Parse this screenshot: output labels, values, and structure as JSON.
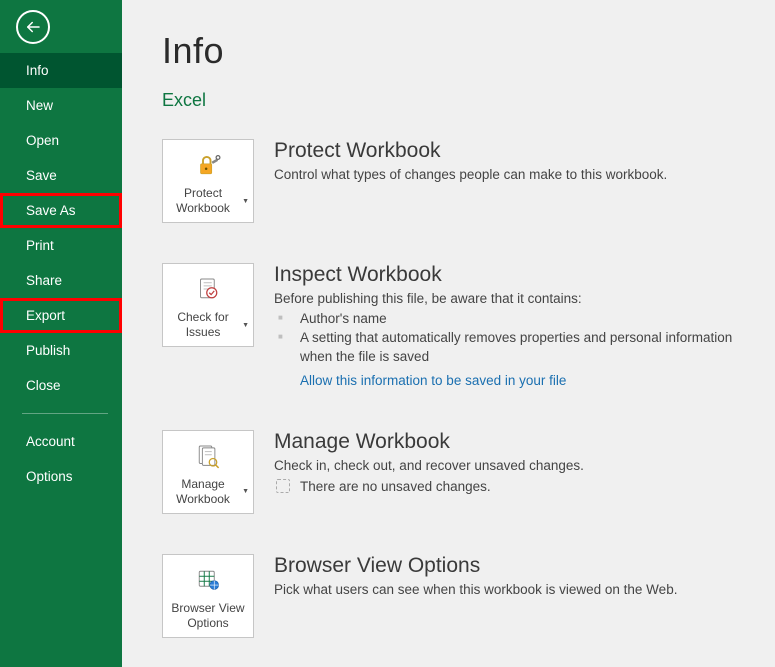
{
  "sidebar": {
    "items": [
      {
        "label": "Info",
        "active": true,
        "highlight": false
      },
      {
        "label": "New",
        "active": false,
        "highlight": false
      },
      {
        "label": "Open",
        "active": false,
        "highlight": false
      },
      {
        "label": "Save",
        "active": false,
        "highlight": false
      },
      {
        "label": "Save As",
        "active": false,
        "highlight": true
      },
      {
        "label": "Print",
        "active": false,
        "highlight": false
      },
      {
        "label": "Share",
        "active": false,
        "highlight": false
      },
      {
        "label": "Export",
        "active": false,
        "highlight": true
      },
      {
        "label": "Publish",
        "active": false,
        "highlight": false
      },
      {
        "label": "Close",
        "active": false,
        "highlight": false
      }
    ],
    "lower": [
      {
        "label": "Account"
      },
      {
        "label": "Options"
      }
    ]
  },
  "page": {
    "title": "Info",
    "docname": "Excel"
  },
  "sections": {
    "protect": {
      "tile": "Protect Workbook",
      "title": "Protect Workbook",
      "desc": "Control what types of changes people can make to this workbook."
    },
    "inspect": {
      "tile": "Check for Issues",
      "title": "Inspect Workbook",
      "desc": "Before publishing this file, be aware that it contains:",
      "bullets": [
        "Author's name",
        "A setting that automatically removes properties and personal information when the file is saved"
      ],
      "link": "Allow this information to be saved in your file"
    },
    "manage": {
      "tile": "Manage Workbook",
      "title": "Manage Workbook",
      "desc": "Check in, check out, and recover unsaved changes.",
      "unsaved": "There are no unsaved changes."
    },
    "browser": {
      "tile": "Browser View Options",
      "title": "Browser View Options",
      "desc": "Pick what users can see when this workbook is viewed on the Web."
    }
  }
}
